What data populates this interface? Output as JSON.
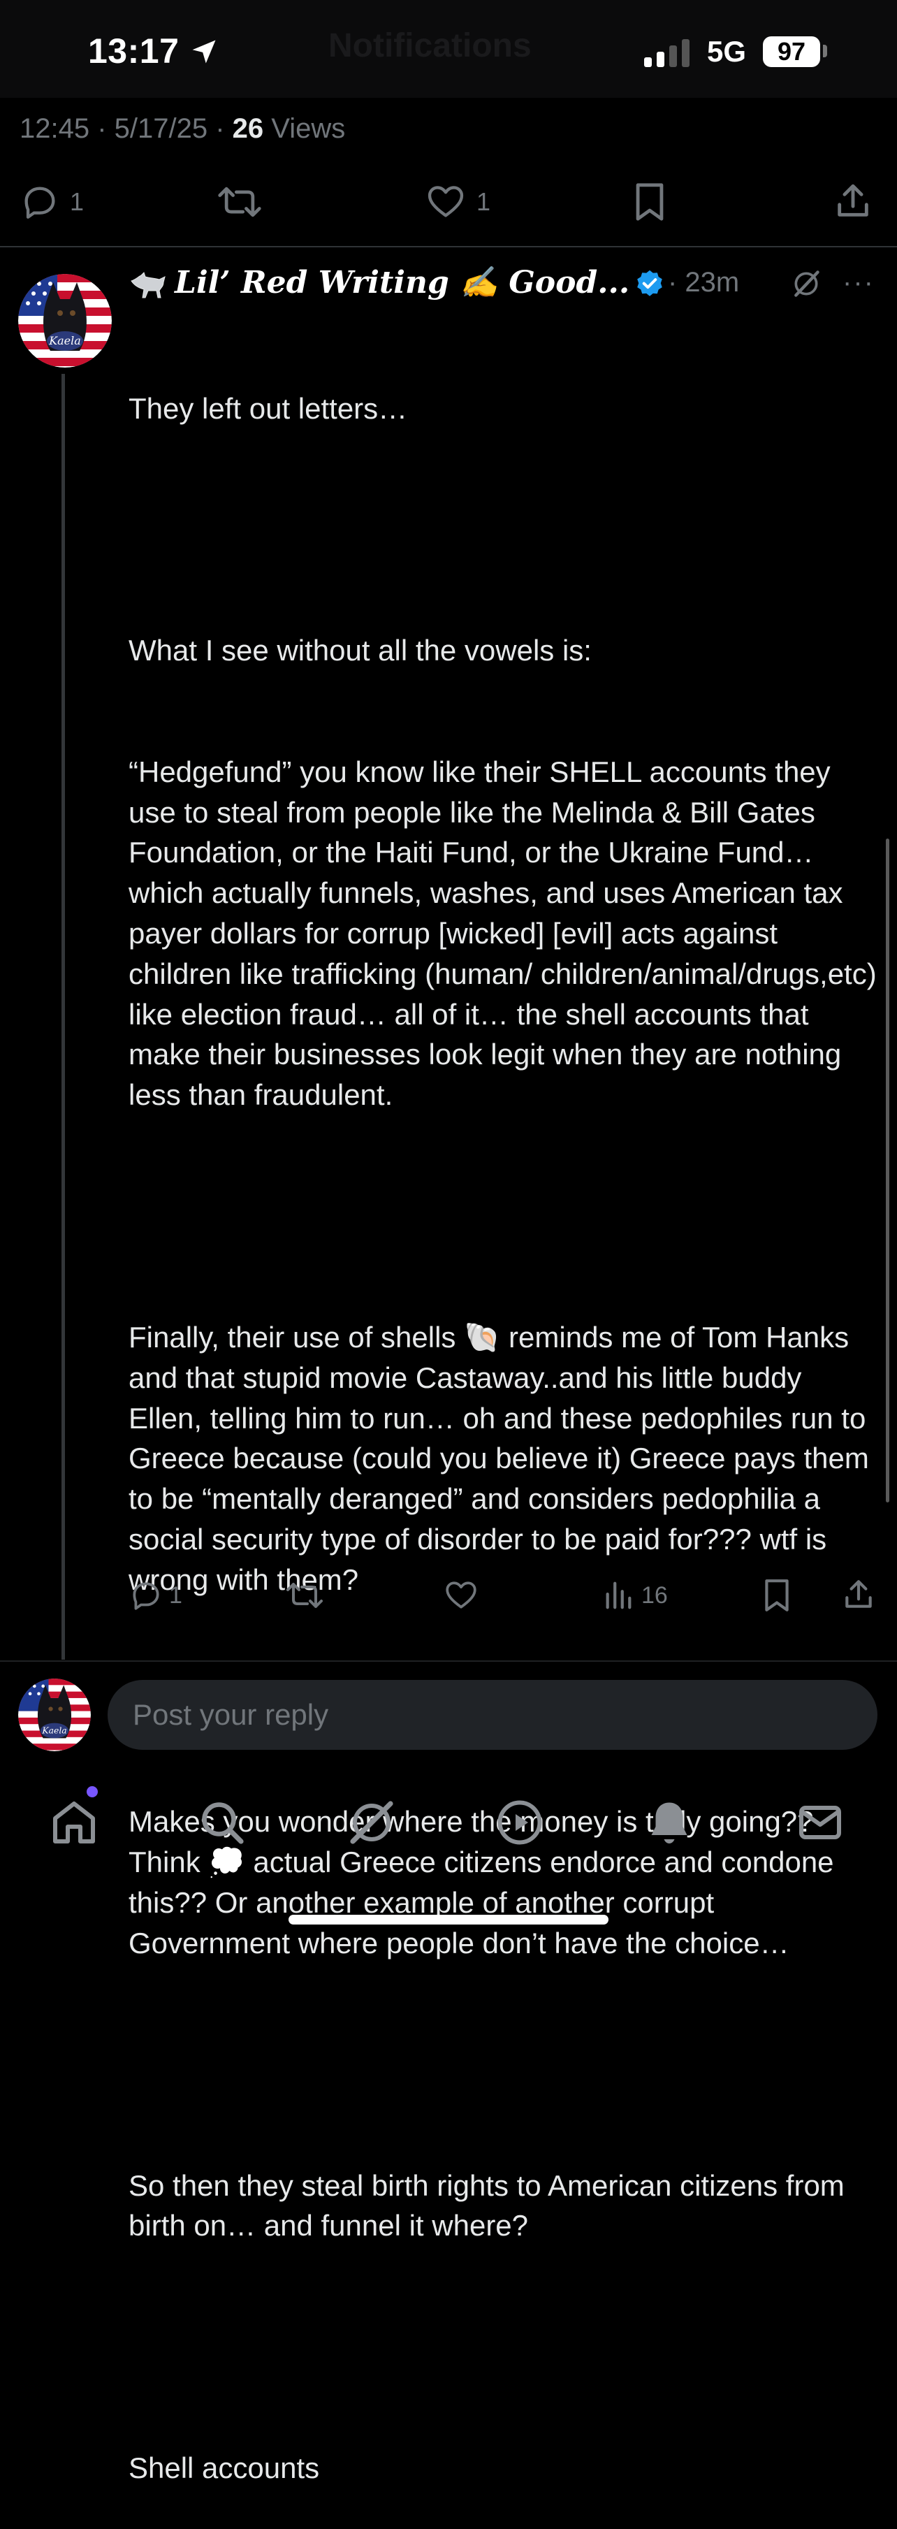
{
  "status_bar": {
    "time": "13:17",
    "network": "5G",
    "battery": "97",
    "ghost_title": "Notifications"
  },
  "post_meta": {
    "timestamp": "12:45 · 5/17/25 · ",
    "views_count": "26",
    "views_label": " Views"
  },
  "post_actions": {
    "replies": "1",
    "likes": "1"
  },
  "reply": {
    "author": "Lil’ Red Writing ✍️ Good...",
    "time": "· 23m",
    "avatar_text": "Kaela",
    "paragraphs": [
      "They left out letters…",
      "",
      "What I see without all the vowels is:",
      "“Hedgefund” you know like their SHELL accounts they use to steal from people like the Melinda & Bill Gates Foundation, or the Haiti Fund, or the Ukraine Fund… which actually funnels, washes, and uses American tax payer dollars for corrup [wicked] [evil] acts against children like trafficking (human/ children/animal/drugs,etc) like election fraud… all of it… the shell accounts that make their businesses look legit when they are nothing less than fraudulent.",
      "",
      "Finally, their use of shells 🐚 reminds me of Tom Hanks and that stupid movie Castaway..and his little buddy Ellen, telling him to run… oh and these pedophiles run to Greece because (could you believe it) Greece pays them to be “mentally deranged” and considers pedophilia a social security type of disorder to be paid for??? wtf is wrong with them?",
      "",
      "Makes you wonder where the money is truly going?? Think 💭 actual Greece citizens endorce and condone this?? Or another example of another corrupt Government where people don’t have the choice…",
      "",
      "So then they steal birth rights to American citizens from birth on… and funnel it where?",
      "",
      "Shell accounts"
    ],
    "actions": {
      "replies": "1",
      "views": "16"
    }
  },
  "composer": {
    "placeholder": "Post your reply"
  },
  "tabbar": {
    "items": [
      "home-icon",
      "search-icon",
      "grok-icon",
      "video-icon",
      "notifications-icon",
      "messages-icon"
    ]
  },
  "colors": {
    "background": "#000000",
    "text": "#e7e9ea",
    "muted": "#71767b",
    "verified": "#1d9bf0",
    "notification_dot": "#7856ff"
  }
}
